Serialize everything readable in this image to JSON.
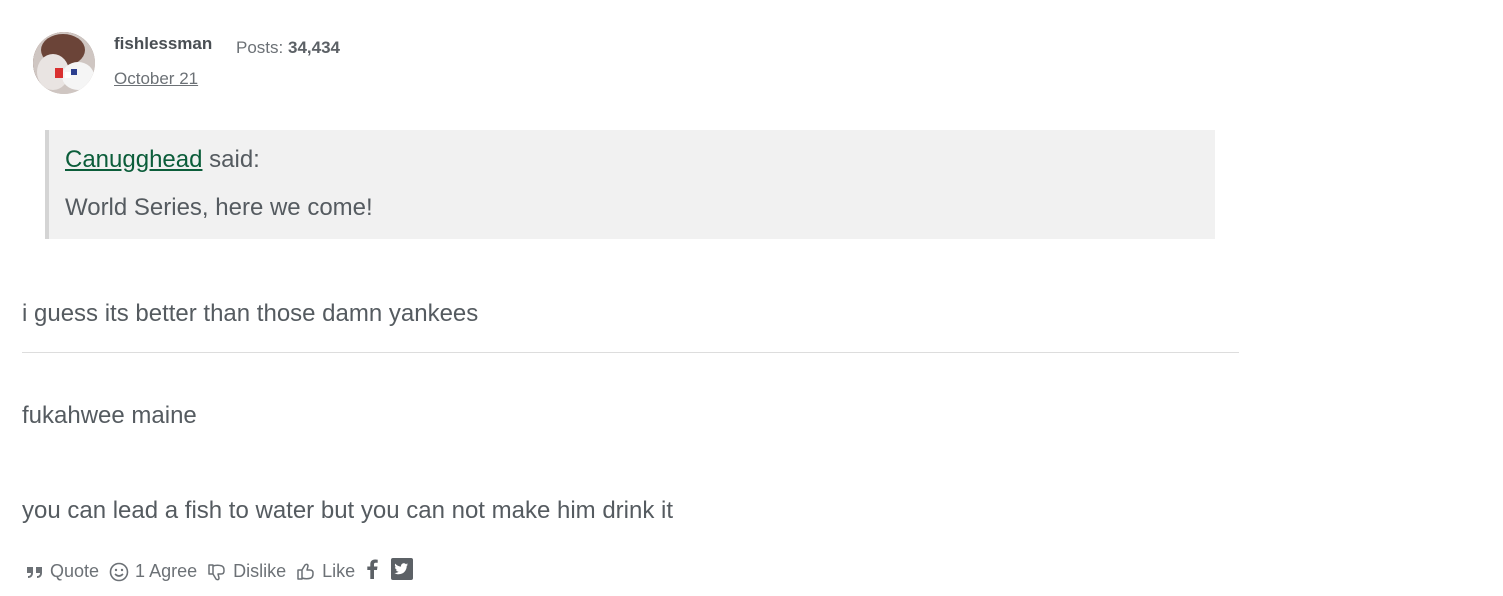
{
  "post": {
    "author": "fishlessman",
    "posts_label": "Posts:",
    "posts_count": "34,434",
    "date": "October 21",
    "quote": {
      "author": "Canugghead",
      "said": "said:",
      "text": "World Series, here we come!"
    },
    "body": "i guess its better than those damn yankees",
    "signature": {
      "line1": "fukahwee maine",
      "line2": "you can lead a fish to water but you can not make him drink it"
    }
  },
  "actions": {
    "quote_label": "Quote",
    "agree_label": "1 Agree",
    "dislike_label": "Dislike",
    "like_label": "Like",
    "icons": [
      "quote-icon",
      "smile-icon",
      "thumbs-down-icon",
      "thumbs-up-icon",
      "facebook-icon",
      "twitter-icon"
    ]
  },
  "colors": {
    "link_green": "#0b5d3a",
    "text": "#555b60",
    "quote_bg": "#f1f1f1"
  }
}
